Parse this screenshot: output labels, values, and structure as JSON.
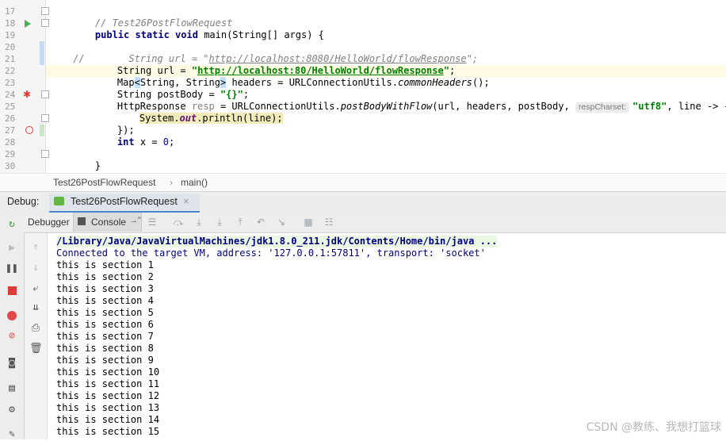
{
  "editor": {
    "line_numbers": [
      "17",
      "18",
      "19",
      "20",
      "21",
      "22",
      "23",
      "24",
      "25",
      "26",
      "27",
      "28",
      "29",
      "30"
    ],
    "line17": {
      "comment": "// Test26PostFlowRequest"
    },
    "line18": {
      "kw": "public static void ",
      "rest": "main(String[] args) {"
    },
    "line20": {
      "comment_marker": "//",
      "indent": "      ",
      "decl": "String url = ",
      "url": "http://localhost:8080/HelloWorld/flowResponse",
      "end": "\";"
    },
    "line21": {
      "decl": "String url = ",
      "q1": "\"",
      "url": "http://localhost:80/HelloWorld/flowResponse",
      "q2": "\"",
      "end": ";"
    },
    "line22": {
      "a": "Map",
      "b": "<",
      "c": "String, String",
      "d": ">",
      "e": " headers = URLConnectionUtils.",
      "m": "commonHeaders",
      "f": "();"
    },
    "line23": {
      "a": "String postBody = ",
      "s": "\"{}\"",
      "e": ";"
    },
    "line24": {
      "a": "HttpResponse ",
      "u": "resp",
      "b": " = URLConnectionUtils.",
      "m": "postBodyWithFlow",
      "c": "(url, headers, postBody, ",
      "hint": "respCharset:",
      "s": "\"utf8\"",
      "d": ", line -> {"
    },
    "line25": {
      "a": "System.",
      "f": "out",
      "b": ".println(line);"
    },
    "line26": {
      "text": "});"
    },
    "line27": {
      "kw": "int",
      "a": " x = ",
      "n": "0",
      "e": ";"
    },
    "line29": {
      "text": "}"
    }
  },
  "breadcrumb": {
    "cls": "Test26PostFlowRequest",
    "sep": "›",
    "method": "main()"
  },
  "debug_panel": {
    "label": "Debug:",
    "tab_title": "Test26PostFlowRequest",
    "tab_close": "×",
    "tabs": {
      "debugger": "Debugger",
      "console": "Console",
      "console_suffix": "→\""
    }
  },
  "console": {
    "command": "/Library/Java/JavaVirtualMachines/jdk1.8.0_211.jdk/Contents/Home/bin/java ...",
    "connected": "Connected to the target VM, address: '127.0.0.1:57811', transport: 'socket'",
    "lines": [
      "this is section 1",
      "this is section 2",
      "this is section 3",
      "this is section 4",
      "this is section 5",
      "this is section 6",
      "this is section 7",
      "this is section 8",
      "this is section 9",
      "this is section 10",
      "this is section 11",
      "this is section 12",
      "this is section 13",
      "this is section 14",
      "this is section 15"
    ]
  },
  "watermark": "CSDN @教练、我想打篮球",
  "colors": {
    "keyword": "#000080",
    "string": "#008000",
    "number": "#0000ff",
    "accent": "#4a88c7"
  },
  "icons": [
    "run-gutter-icon",
    "breakpoint-icon",
    "fold-icon",
    "rerun-icon",
    "resume-icon",
    "pause-icon",
    "stop-icon",
    "view-breakpoints-icon",
    "mute-breakpoints-icon",
    "camera-icon",
    "layout-icon",
    "settings-icon",
    "pin-icon",
    "up-arrow-icon",
    "down-arrow-icon",
    "soft-wrap-icon",
    "scroll-end-icon",
    "print-icon",
    "trash-icon"
  ]
}
